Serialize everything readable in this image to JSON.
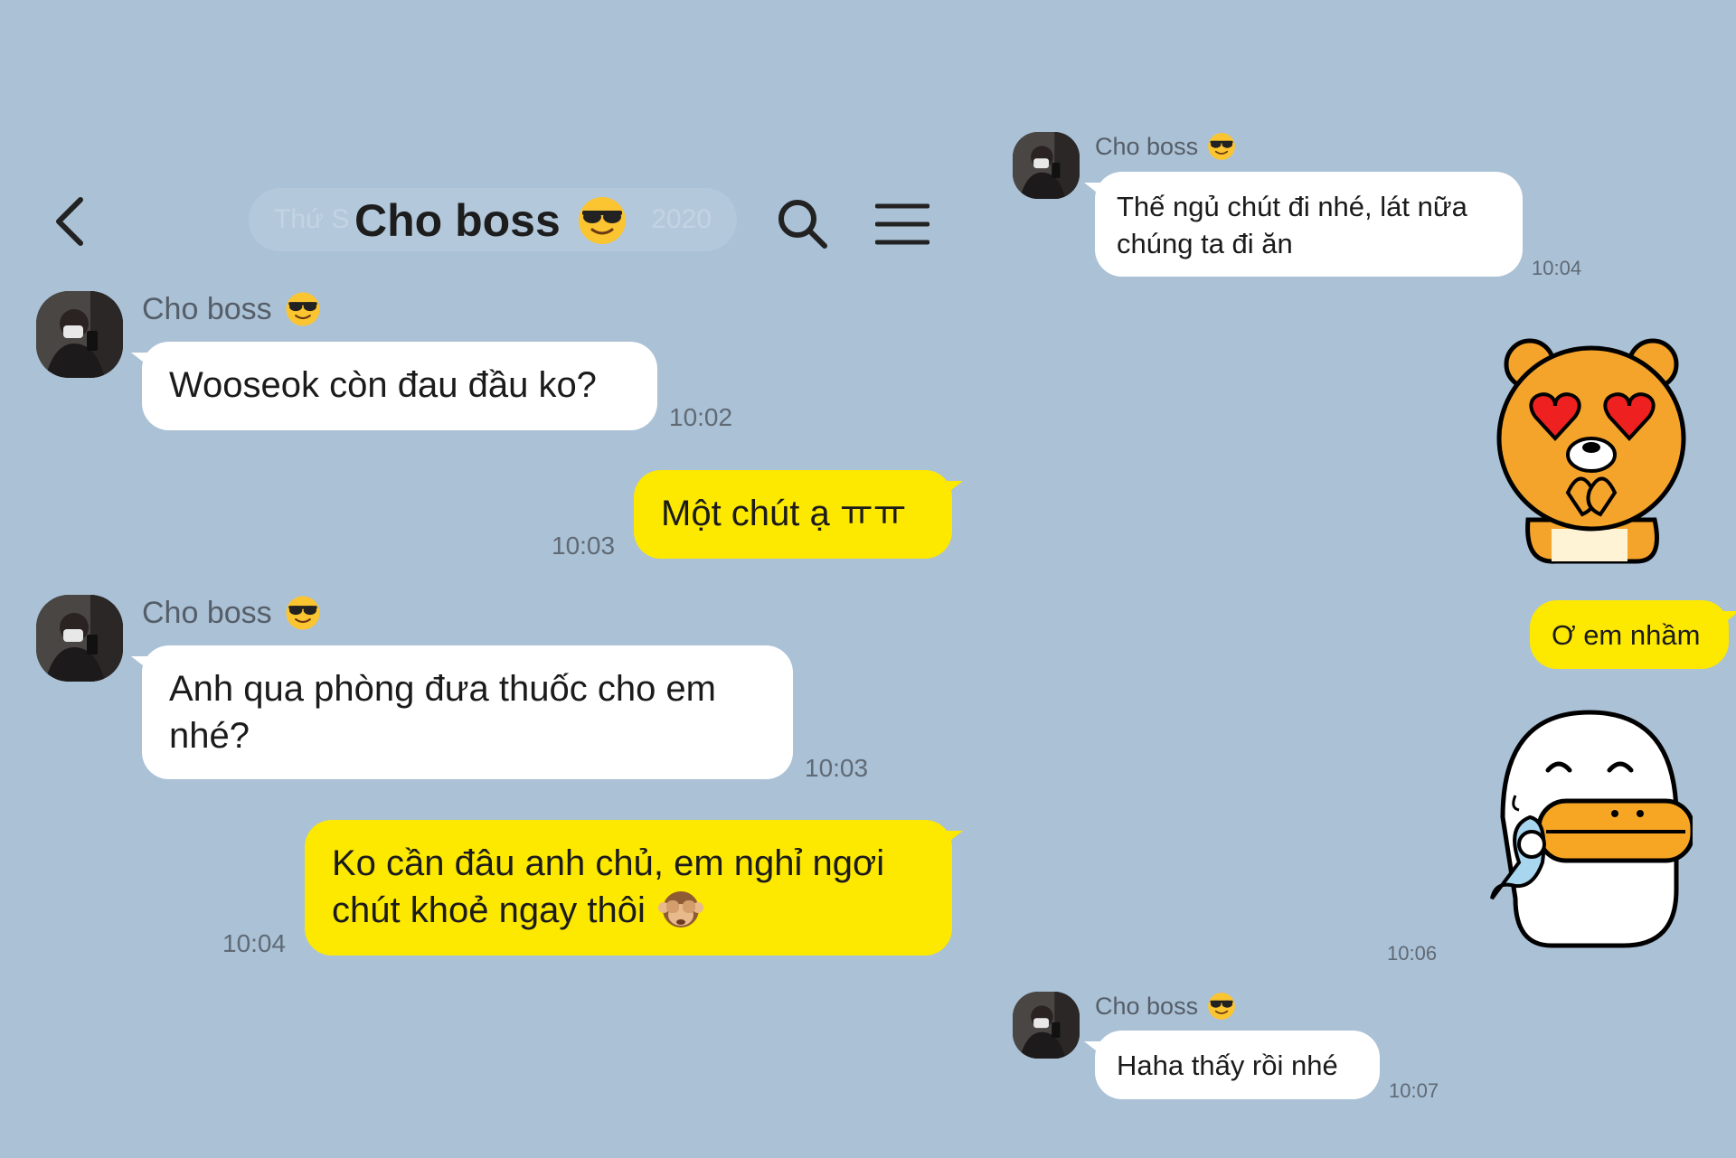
{
  "header": {
    "date_left": "Thứ S",
    "date_right": "2020",
    "title": "Cho boss",
    "title_emoji": "sunglasses-emoji"
  },
  "left_chat": {
    "messages": [
      {
        "sender": "Cho boss",
        "text": "Wooseok còn đau đầu ko?",
        "time": "10:02"
      },
      {
        "text": "Một chút ạ ㅠㅠ",
        "time": "10:03"
      },
      {
        "sender": "Cho boss",
        "text_line1": "Anh qua phòng đưa thuốc cho em",
        "text_line2": "nhé?",
        "time": "10:03"
      },
      {
        "text_line1": "Ko cần đâu anh chủ, em nghỉ ngơi",
        "text_line2": "chút khoẻ ngay thôi",
        "emoji": "see-no-evil-monkey",
        "time": "10:04"
      }
    ]
  },
  "right_chat": {
    "messages": [
      {
        "sender": "Cho boss",
        "text_line1": "Thế ngủ chút đi nhé, lát nữa",
        "text_line2": "chúng ta đi ăn",
        "time": "10:04"
      },
      {
        "sticker": "ryan-heart-eyes-sticker"
      },
      {
        "text": "Ơ em nhầm"
      },
      {
        "sticker": "tube-duck-crying-sticker",
        "time": "10:06"
      },
      {
        "sender": "Cho boss",
        "text": "Haha thấy rồi nhé",
        "time": "10:07"
      }
    ]
  },
  "colors": {
    "background": "#abc1d6",
    "my_bubble": "#fde800",
    "their_bubble": "#ffffff",
    "timestamp": "#5f6a75"
  }
}
